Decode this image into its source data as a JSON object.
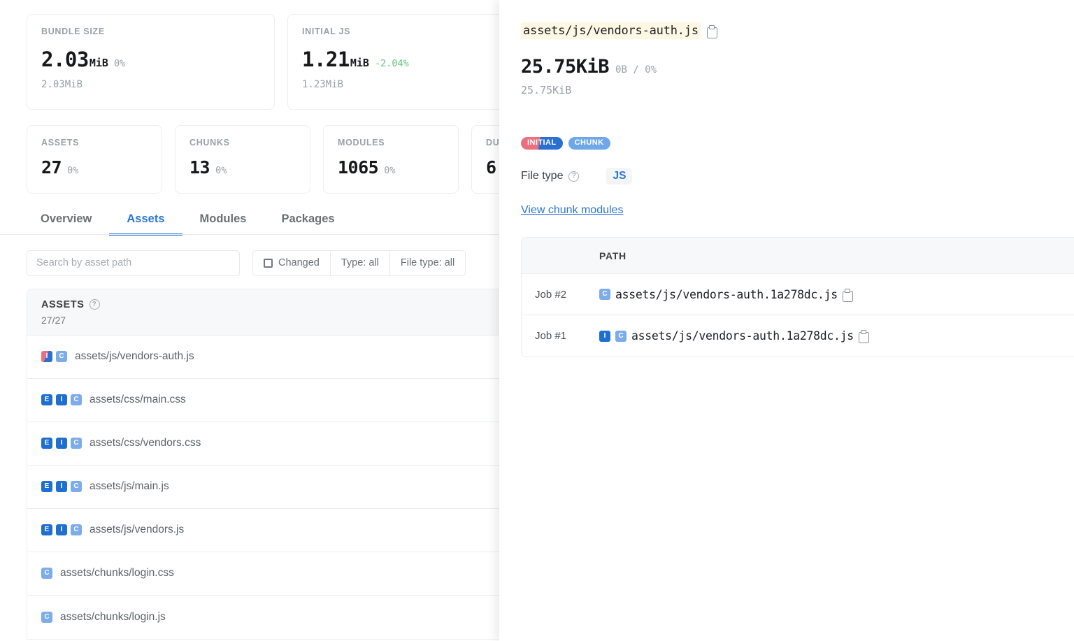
{
  "stats_primary": [
    {
      "label": "BUNDLE SIZE",
      "value": "2.03",
      "unit": "MiB",
      "delta": "0%",
      "delta_kind": "neutral",
      "baseline": "2.03MiB"
    },
    {
      "label": "INITIAL JS",
      "value": "1.21",
      "unit": "MiB",
      "delta": "-2.04%",
      "delta_kind": "negative",
      "baseline": "1.23MiB"
    }
  ],
  "stats_secondary": [
    {
      "label": "ASSETS",
      "value": "27",
      "delta": "0%"
    },
    {
      "label": "CHUNKS",
      "value": "13",
      "delta": "0%"
    },
    {
      "label": "MODULES",
      "value": "1065",
      "delta": "0%"
    },
    {
      "label": "DU",
      "value": "6",
      "delta": ""
    }
  ],
  "tabs": [
    {
      "label": "Overview",
      "active": false
    },
    {
      "label": "Assets",
      "active": true
    },
    {
      "label": "Modules",
      "active": false
    },
    {
      "label": "Packages",
      "active": false
    }
  ],
  "filters": {
    "search_placeholder": "Search by asset path",
    "search_value": "",
    "changed_label": "Changed",
    "type_label": "Type: all",
    "file_type_label": "File type: all"
  },
  "assets_list": {
    "title": "ASSETS",
    "count": "27/27",
    "rows": [
      {
        "badges": [
          "CI",
          "C"
        ],
        "path": "assets/js/vendors-auth.js"
      },
      {
        "badges": [
          "E",
          "I",
          "C"
        ],
        "path": "assets/css/main.css"
      },
      {
        "badges": [
          "E",
          "I",
          "C"
        ],
        "path": "assets/css/vendors.css"
      },
      {
        "badges": [
          "E",
          "I",
          "C"
        ],
        "path": "assets/js/main.js"
      },
      {
        "badges": [
          "E",
          "I",
          "C"
        ],
        "path": "assets/js/vendors.js"
      },
      {
        "badges": [
          "C"
        ],
        "path": "assets/chunks/login.css"
      },
      {
        "badges": [
          "C"
        ],
        "path": "assets/chunks/login.js"
      }
    ]
  },
  "detail_panel": {
    "path": "assets/js/vendors-auth.js",
    "size": "25.75KiB",
    "size_delta": "0B / 0%",
    "size_baseline": "25.75KiB",
    "tags": [
      {
        "label": "INITIAL",
        "style": "initial"
      },
      {
        "label": "CHUNK",
        "style": "chunk"
      }
    ],
    "file_type_label": "File type",
    "file_type_value": "JS",
    "view_link": "View chunk modules",
    "table": {
      "col_job_header": "",
      "col_path_header": "PATH",
      "rows": [
        {
          "job": "Job #2",
          "badges": [
            "C"
          ],
          "path": "assets/js/vendors-auth.1a278dc.js"
        },
        {
          "job": "Job #1",
          "badges": [
            "I",
            "C"
          ],
          "path": "assets/js/vendors-auth.1a278dc.js"
        }
      ]
    }
  },
  "colors": {
    "accent_blue": "#2b76d2",
    "badge_blue": "#1f6fd0",
    "badge_light_blue": "#7cacea",
    "changed_red": "#e8707f",
    "positive_green": "#5fc67f",
    "highlight_yellow": "#fdf7e3"
  }
}
